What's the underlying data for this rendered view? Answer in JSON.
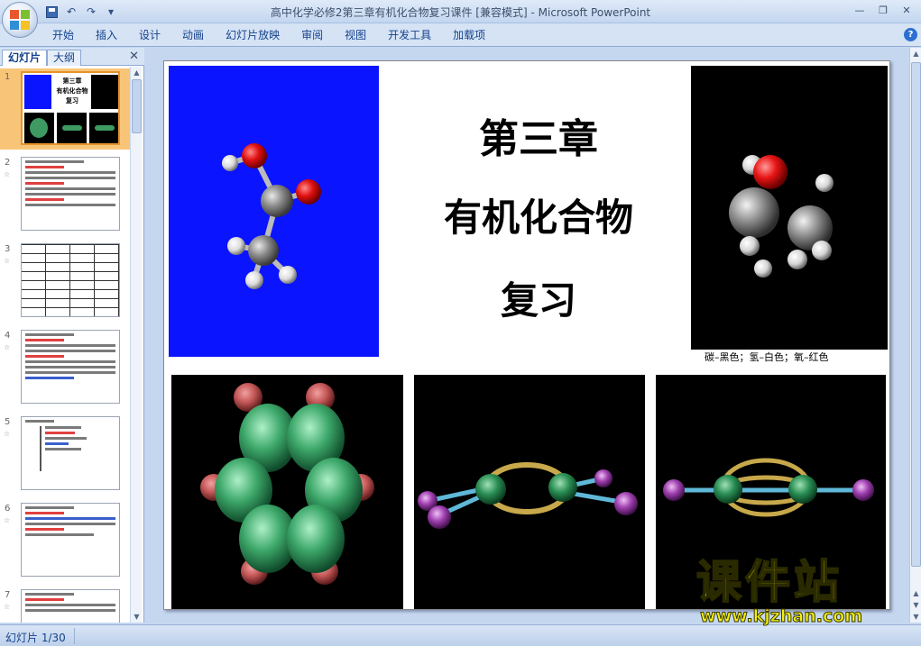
{
  "window": {
    "title": "高中化学必修2第三章有机化合物复习课件 [兼容模式] - Microsoft PowerPoint"
  },
  "qat": {
    "undo_icon": "undo-icon",
    "redo_icon": "redo-icon",
    "customize_icon": "dropdown-arrow-icon"
  },
  "ribbon": {
    "tabs": [
      "开始",
      "插入",
      "设计",
      "动画",
      "幻灯片放映",
      "审阅",
      "视图",
      "开发工具",
      "加载项"
    ]
  },
  "left_pane": {
    "tab_slides": "幻灯片",
    "tab_outline": "大纲",
    "slides": [
      {
        "num": "1"
      },
      {
        "num": "2"
      },
      {
        "num": "3"
      },
      {
        "num": "4"
      },
      {
        "num": "5"
      },
      {
        "num": "6"
      },
      {
        "num": "7"
      }
    ],
    "thumb1": {
      "title_line1": "第三章",
      "title_line2": "有机化合物",
      "title_line3": "复习"
    }
  },
  "slide": {
    "title_line1": "第三章",
    "title_line2": "有机化合物",
    "title_line3": "复习",
    "caption": "碳–黑色；氢–白色；氧–红色"
  },
  "watermark": {
    "text": "课件站",
    "url": "www.kjzhan.com"
  },
  "status": {
    "slide_indicator": "幻灯片 1/30"
  },
  "colors": {
    "ribbon_text": "#15428b",
    "slide_blue_panel": "#0a14ff",
    "selected_thumb": "#f8c578"
  }
}
